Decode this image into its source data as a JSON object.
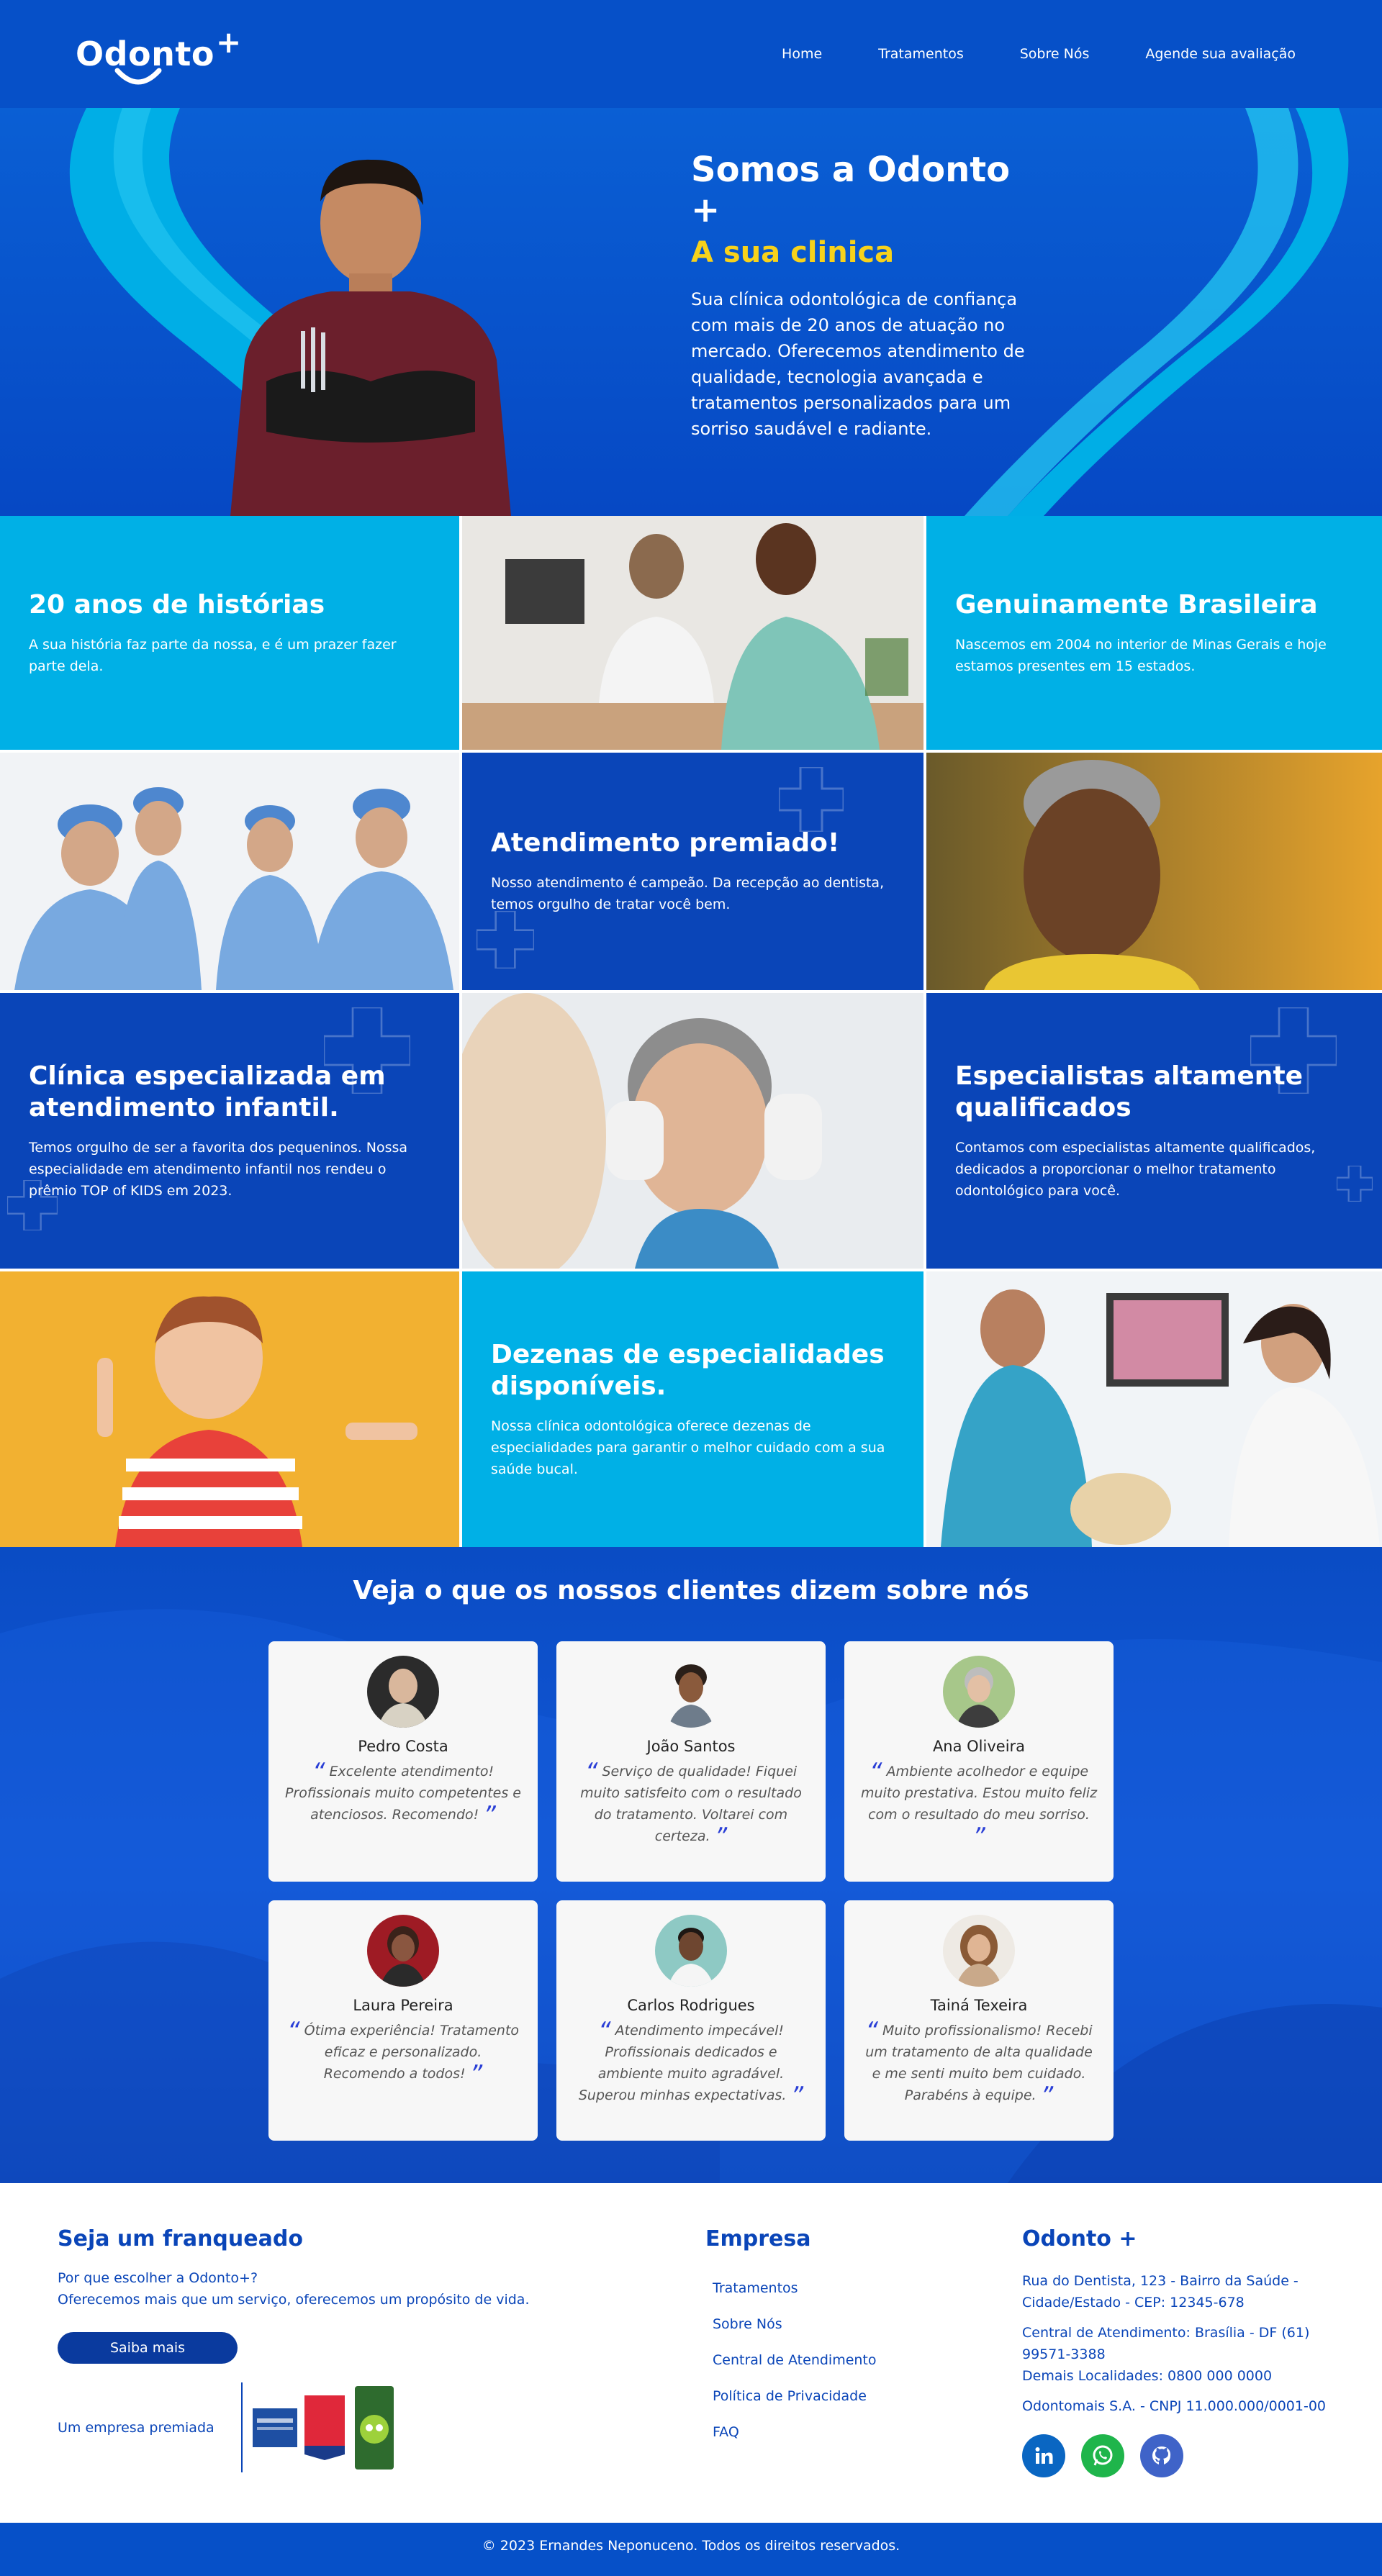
{
  "brand": {
    "name": "Odonto",
    "plus": "+"
  },
  "nav": [
    {
      "label": "Home"
    },
    {
      "label": "Tratamentos"
    },
    {
      "label": "Sobre Nós"
    },
    {
      "label": "Agende sua avaliação"
    }
  ],
  "hero": {
    "title": "Somos a Odonto +",
    "subtitle": "A sua clinica",
    "text": "Sua clínica odontológica de confiança com mais de 20 anos de atuação no mercado. Oferecemos atendimento de qualidade, tecnologia avançada e tratamentos personalizados para um sorriso saudável e radiante."
  },
  "features": [
    {
      "title": "20 anos de histórias",
      "text": "A sua história faz parte da nossa, e é um prazer fazer parte dela."
    },
    {
      "title": "Genuinamente Brasileira",
      "text": "Nascemos em 2004 no interior de Minas Gerais e hoje estamos presentes em 15 estados."
    },
    {
      "title": "Atendimento premiado!",
      "text": "Nosso atendimento é campeão. Da recepção ao dentista, temos orgulho de tratar você bem."
    },
    {
      "title": "Clínica especializada em atendimento infantil.",
      "text": "Temos orgulho de ser a favorita dos pequeninos. Nossa especialidade em atendimento infantil nos rendeu o prêmio TOP of KIDS em 2023."
    },
    {
      "title": "Especialistas altamente qualificados",
      "text": "Contamos com especialistas altamente qualificados, dedicados a proporcionar o melhor tratamento odontológico para você."
    },
    {
      "title": "Dezenas de especialidades disponíveis.",
      "text": "Nossa clínica odontológica oferece dezenas de especialidades para garantir o melhor cuidado com a sua saúde bucal."
    }
  ],
  "testimonials": {
    "title": "Veja o que os nossos clientes dizem sobre nós",
    "items": [
      {
        "name": "Pedro Costa",
        "quote": "Excelente atendimento! Profissionais muito competentes e atenciosos. Recomendo!"
      },
      {
        "name": "João Santos",
        "quote": "Serviço de qualidade! Fiquei muito satisfeito com o resultado do tratamento. Voltarei com certeza."
      },
      {
        "name": "Ana Oliveira",
        "quote": "Ambiente acolhedor e equipe muito prestativa. Estou muito feliz com o resultado do meu sorriso."
      },
      {
        "name": "Laura Pereira",
        "quote": "Ótima experiência! Tratamento eficaz e personalizado. Recomendo a todos!"
      },
      {
        "name": "Carlos Rodrigues",
        "quote": "Atendimento impecável! Profissionais dedicados e ambiente muito agradável. Superou minhas expectativas."
      },
      {
        "name": "Tainá Texeira",
        "quote": "Muito profissionalismo! Recebi um tratamento de alta qualidade e me senti muito bem cuidado. Parabéns à equipe."
      }
    ]
  },
  "footer": {
    "franchise": {
      "title": "Seja um franqueado",
      "line1": "Por que escolher a Odonto+?",
      "line2": "Oferecemos mais que um serviço, oferecemos um propósito de vida.",
      "button": "Saiba mais",
      "award_label": "Um empresa premiada"
    },
    "company": {
      "title": "Empresa",
      "links": [
        "Tratamentos",
        "Sobre Nós",
        "Central de Atendimento",
        "Política de Privacidade",
        "FAQ"
      ]
    },
    "contact": {
      "title": "Odonto +",
      "address": "Rua do Dentista, 123 - Bairro da Saúde - Cidade/Estado - CEP: 12345-678",
      "phone_central": "Central de Atendimento: Brasília - DF (61) 99571-3388",
      "phone_other": "Demais Localidades: 0800 000 0000",
      "cnpj": "Odontomais S.A. - CNPJ 11.000.000/0001-00"
    },
    "social": [
      "linkedin-icon",
      "whatsapp-icon",
      "github-icon"
    ],
    "copyright": "© 2023 Ernandes Neponuceno. Todos os direitos reservados."
  }
}
